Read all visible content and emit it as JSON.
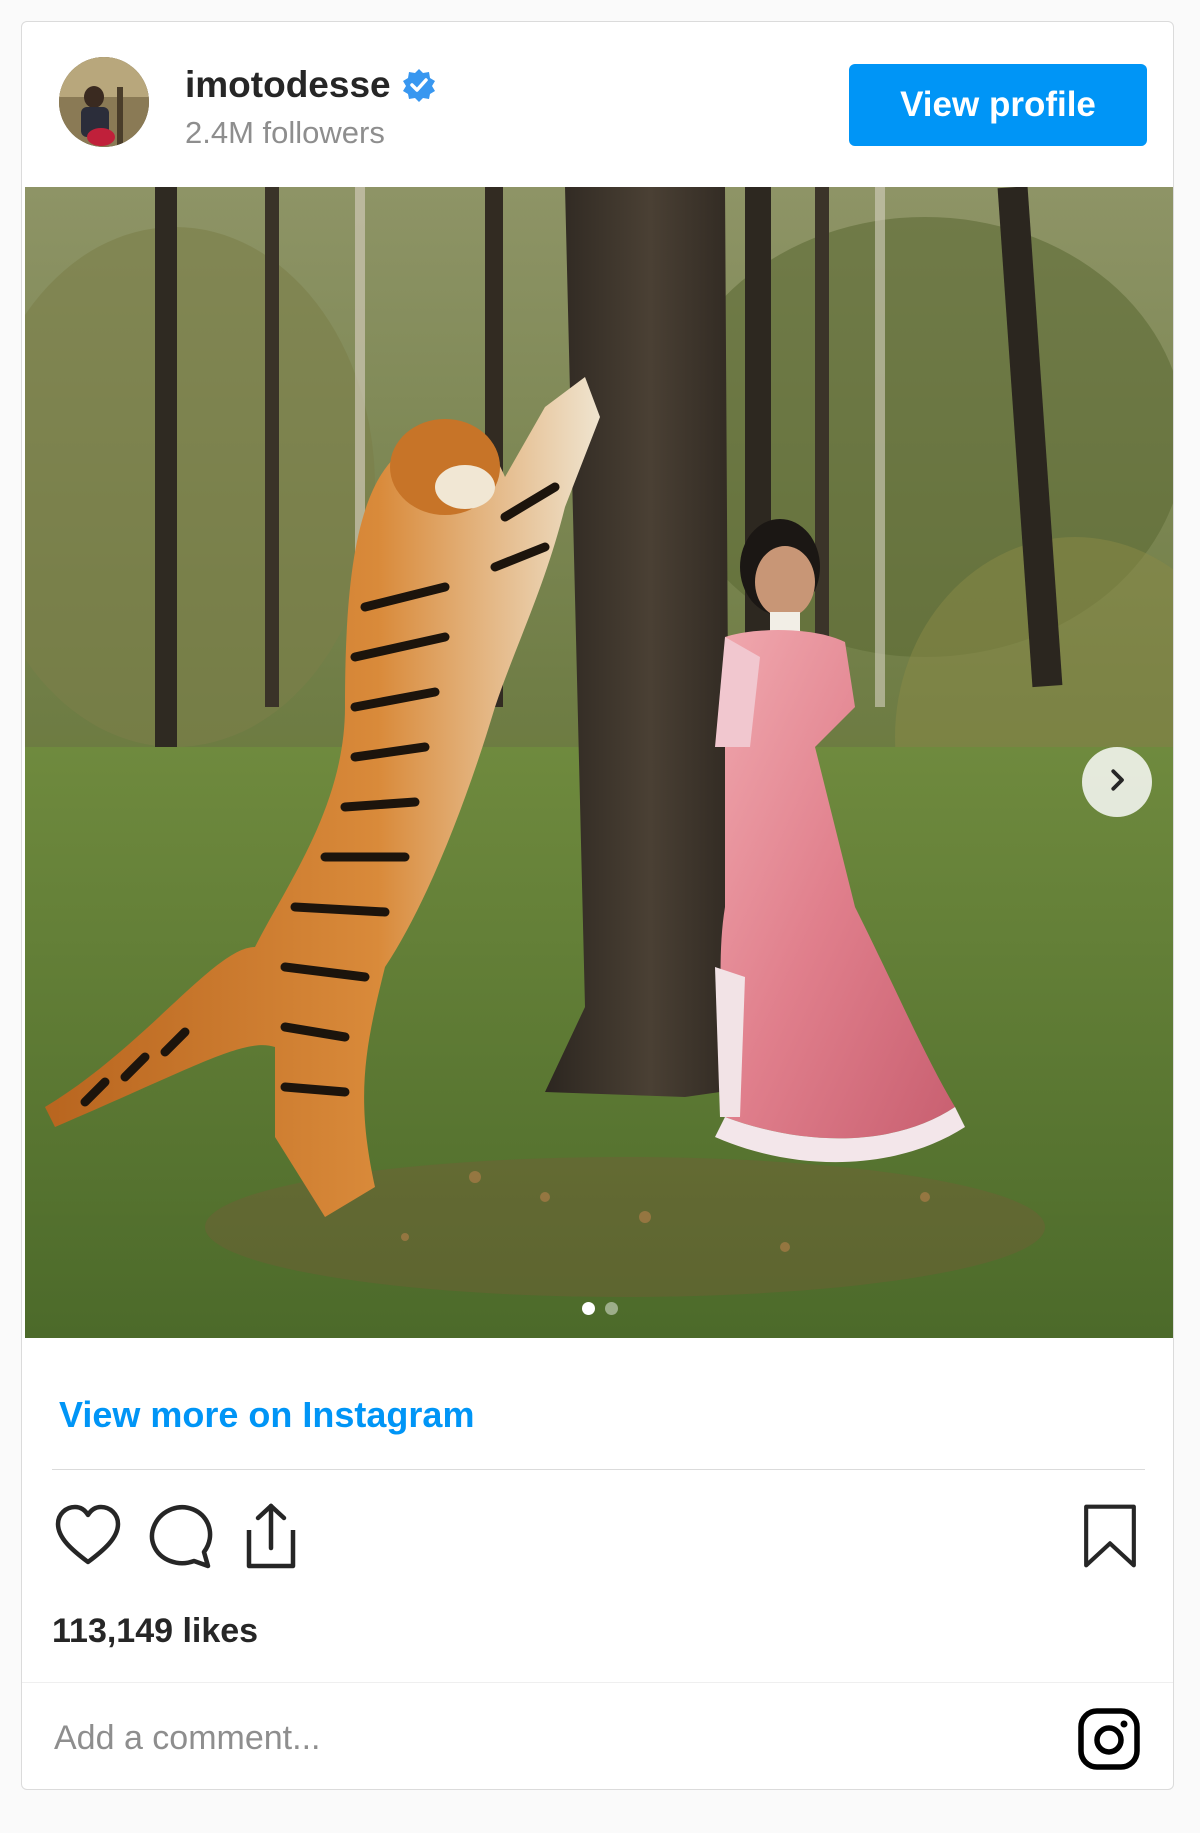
{
  "header": {
    "username": "imotodesse",
    "followers": "2.4M followers",
    "view_profile_label": "View profile"
  },
  "media": {
    "carousel_count": 2,
    "active_index": 0,
    "next_icon": "chevron-right-icon"
  },
  "links": {
    "view_more": "View more on Instagram"
  },
  "actions": {
    "icons": [
      "heart-icon",
      "comment-icon",
      "share-icon",
      "bookmark-icon"
    ]
  },
  "likes": "113,149 likes",
  "comment": {
    "placeholder": "Add a comment..."
  },
  "colors": {
    "accent": "#0095f6",
    "verified": "#3897f0",
    "text": "#262626",
    "muted": "#8e8e8e",
    "border": "#dbdbdb"
  }
}
